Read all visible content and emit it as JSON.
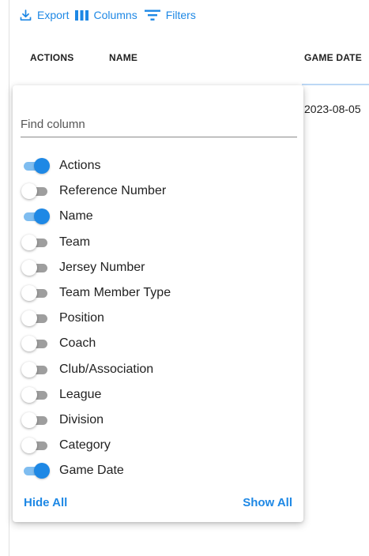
{
  "toolbar": {
    "export_label": "Export",
    "columns_label": "Columns",
    "filters_label": "Filters"
  },
  "table": {
    "headers": {
      "actions": "ACTIONS",
      "name": "NAME",
      "game_date": "GAME DATE"
    },
    "rows": [
      {
        "game_date": "2023-08-05"
      }
    ]
  },
  "column_panel": {
    "search": {
      "value": "",
      "placeholder": "Find column"
    },
    "columns": [
      {
        "label": "Actions",
        "visible": true
      },
      {
        "label": "Reference Number",
        "visible": false
      },
      {
        "label": "Name",
        "visible": true
      },
      {
        "label": "Team",
        "visible": false
      },
      {
        "label": "Jersey Number",
        "visible": false
      },
      {
        "label": "Team Member Type",
        "visible": false
      },
      {
        "label": "Position",
        "visible": false
      },
      {
        "label": "Coach",
        "visible": false
      },
      {
        "label": "Club/Association",
        "visible": false
      },
      {
        "label": "League",
        "visible": false
      },
      {
        "label": "Division",
        "visible": false
      },
      {
        "label": "Category",
        "visible": false
      },
      {
        "label": "Game Date",
        "visible": true
      }
    ],
    "hide_all_label": "Hide All",
    "show_all_label": "Show All"
  },
  "colors": {
    "accent": "#1e88e5",
    "switch_on_track": "#7fbdf0",
    "switch_off_track": "#9e9e9e"
  },
  "icons": {
    "export": "download-icon",
    "columns": "view-column-icon",
    "filters": "filter-list-icon"
  }
}
